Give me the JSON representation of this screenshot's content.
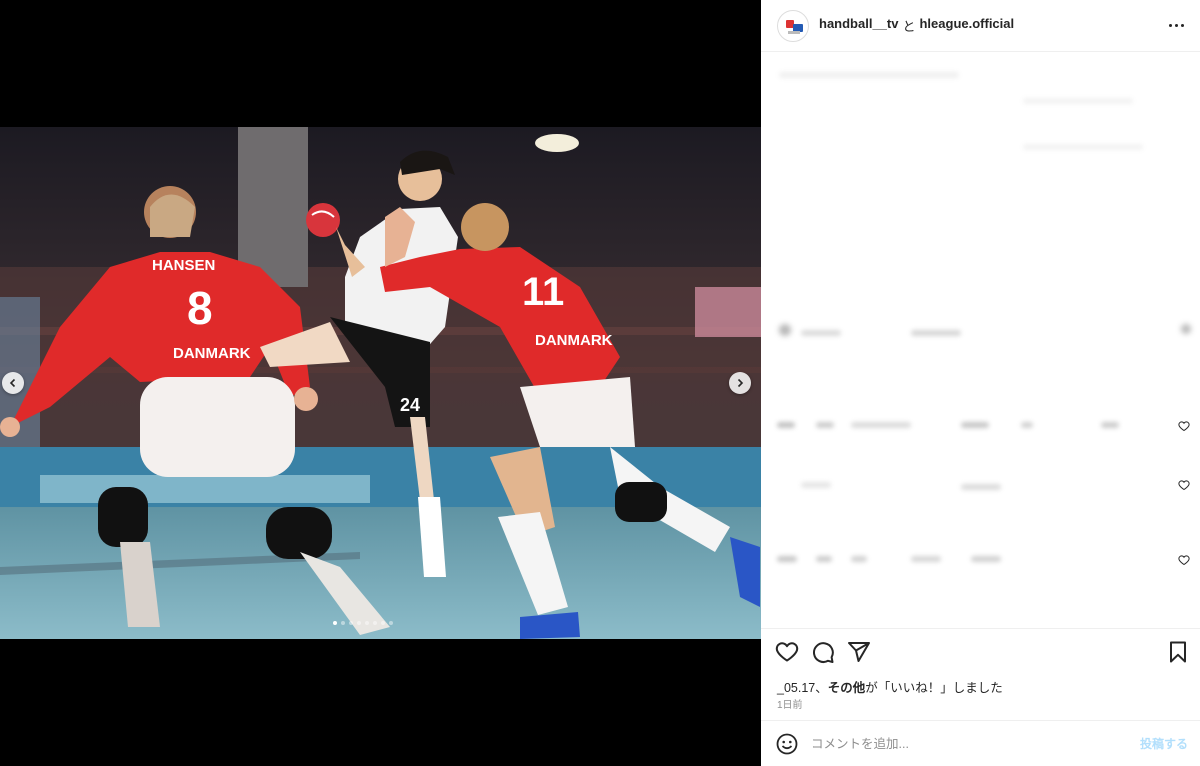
{
  "post": {
    "accounts": {
      "user1": "handball__tv",
      "separator": "と",
      "user2": "hleague.official"
    },
    "media": {
      "description_icon": "handball-photo",
      "jersey_numbers": [
        "8",
        "24",
        "11"
      ],
      "jersey_names": [
        "HANSEN",
        "DANMARK",
        "DANMARK"
      ],
      "slide_count": 8,
      "active_slide": 0
    },
    "likes": {
      "prefix": "_05.17、",
      "bold": "その他",
      "suffix": "が「いいね！」しました"
    },
    "time": "1日前",
    "comment_placeholder": "コメントを追加...",
    "post_label": "投稿する"
  },
  "colors": {
    "accent_blue": "#b2dffc",
    "text": "#262626",
    "muted": "#8e8e8e",
    "denmark_red": "#e02a2a"
  }
}
